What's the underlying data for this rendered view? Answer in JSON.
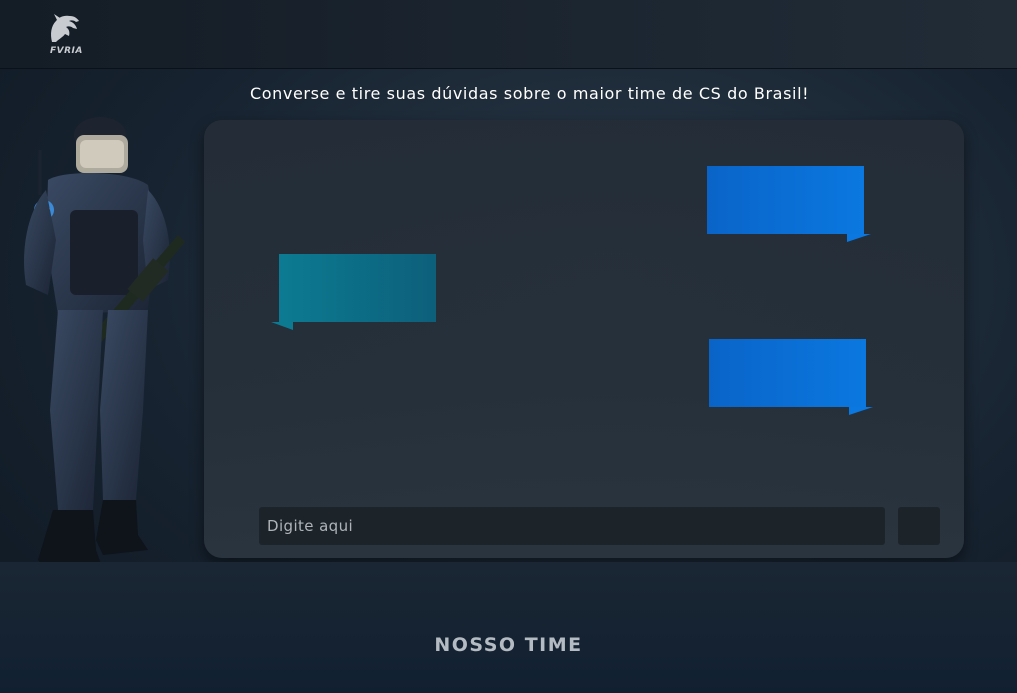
{
  "header": {
    "logo_text": "FVRIA",
    "logo_icon": "panther-logo-icon"
  },
  "headline": "Converse e tire suas dúvidas sobre o maior time de CS do Brasil!",
  "hero": {
    "icon": "soldier-character-illustration"
  },
  "chat": {
    "messages": [
      {
        "side": "right",
        "text": ""
      },
      {
        "side": "left",
        "text": ""
      },
      {
        "side": "right",
        "text": ""
      }
    ],
    "input": {
      "placeholder": "Digite aqui",
      "value": ""
    },
    "send_icon": "send-button"
  },
  "footer": {
    "section_title": "NOSSO TIME"
  },
  "colors": {
    "bubble_bot": "#0a78e0",
    "bubble_user": "#0c7b92",
    "panel": "#242d37",
    "background": "#172330"
  }
}
